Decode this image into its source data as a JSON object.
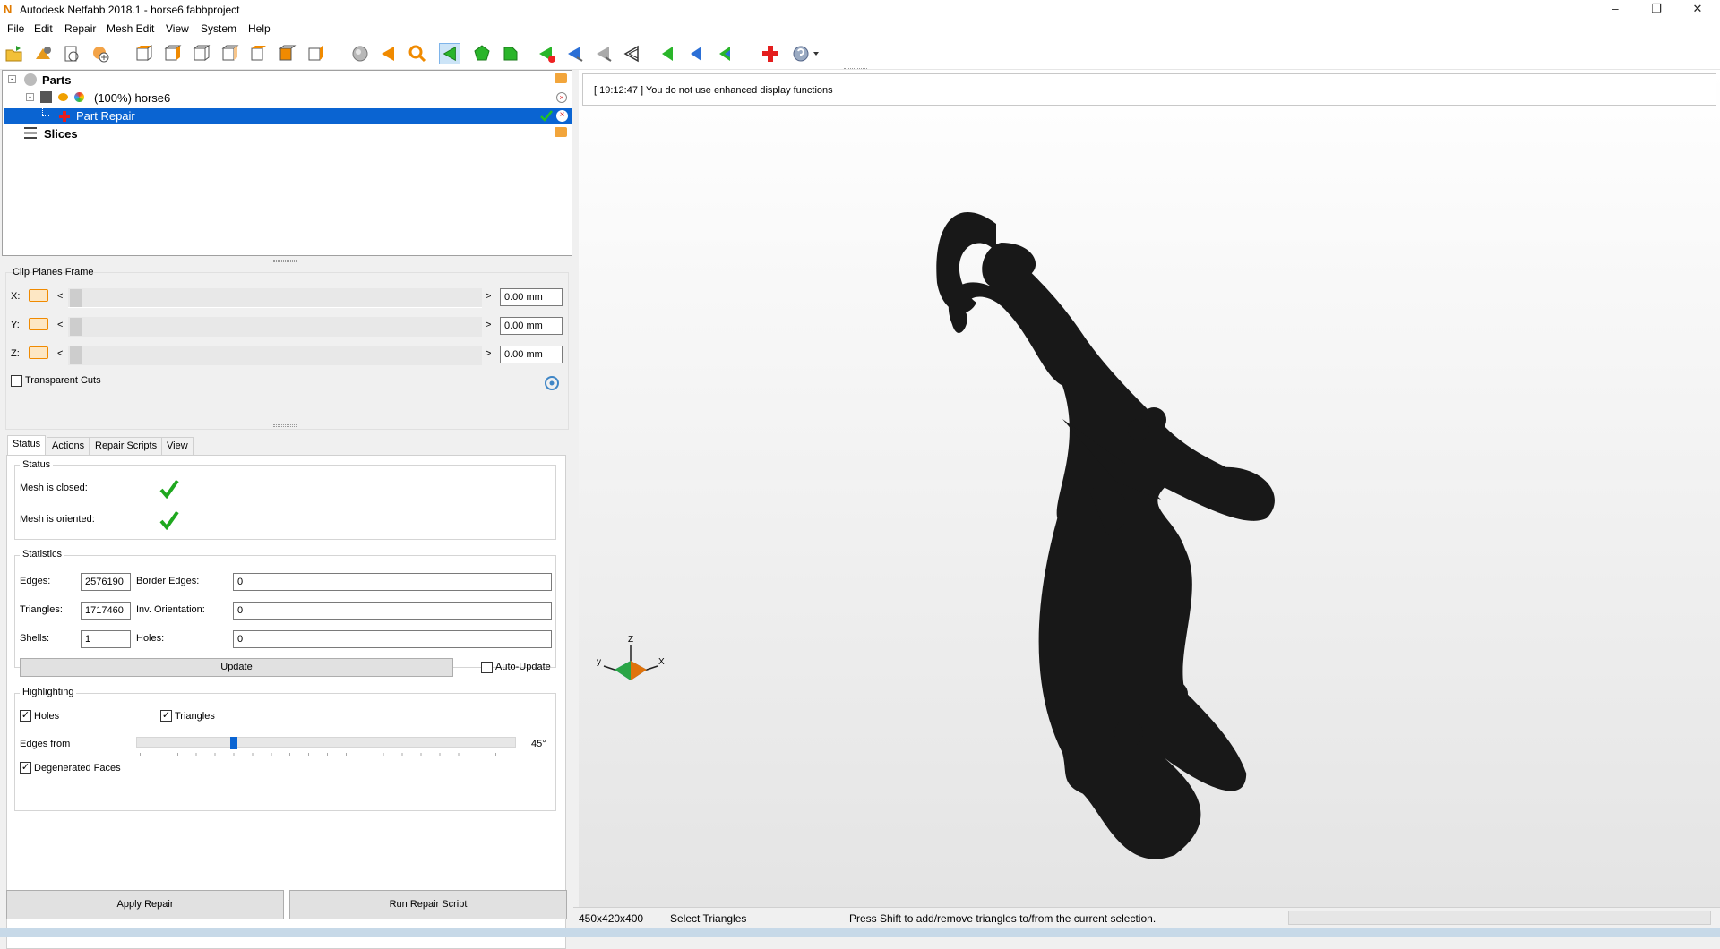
{
  "window": {
    "title": "Autodesk Netfabb 2018.1 - horse6.fabbproject",
    "app_icon": "netfabb-n-icon"
  },
  "menu": [
    "File",
    "Edit",
    "Repair",
    "Mesh Edit",
    "View",
    "System",
    "Help"
  ],
  "tree": {
    "parts_label": "Parts",
    "part_label": "(100%) horse6",
    "repair_label": "Part Repair",
    "slices_label": "Slices"
  },
  "clip": {
    "title": "Clip Planes Frame",
    "x_label": "X:",
    "y_label": "Y:",
    "z_label": "Z:",
    "x_value": "0.00 mm",
    "y_value": "0.00 mm",
    "z_value": "0.00 mm",
    "less": "<",
    "more": ">",
    "transparent_label": "Transparent Cuts"
  },
  "tabs": [
    "Status",
    "Actions",
    "Repair Scripts",
    "View"
  ],
  "status": {
    "group": "Status",
    "closed_label": "Mesh is closed:",
    "oriented_label": "Mesh is oriented:"
  },
  "stats": {
    "group": "Statistics",
    "edges_label": "Edges:",
    "edges": "2576190",
    "border_label": "Border Edges:",
    "border": "0",
    "triangles_label": "Triangles:",
    "triangles": "1717460",
    "inv_label": "Inv. Orientation:",
    "inv": "0",
    "shells_label": "Shells:",
    "shells": "1",
    "holes_label": "Holes:",
    "holes": "0",
    "update_label": "Update",
    "autoupdate_label": "Auto-Update"
  },
  "highlight": {
    "group": "Highlighting",
    "holes_label": "Holes",
    "triangles_label": "Triangles",
    "edges_label": "Edges from",
    "edges_value": "45°",
    "edges_level": 0.25,
    "degenerated_label": "Degenerated Faces"
  },
  "buttons": {
    "apply": "Apply Repair",
    "run": "Run Repair Script"
  },
  "log": "[ 19:12:47 ] You do not use enhanced display functions",
  "axes": {
    "z": "Z",
    "x": "X",
    "y": "y"
  },
  "statusbar": {
    "size": "450x420x400",
    "mode": "Select Triangles",
    "hint": "Press Shift to add/remove triangles to/from the current selection."
  },
  "colors": {
    "selection": "#0a64d2",
    "check": "#1fa81f",
    "accent_orange": "#f08a00"
  }
}
